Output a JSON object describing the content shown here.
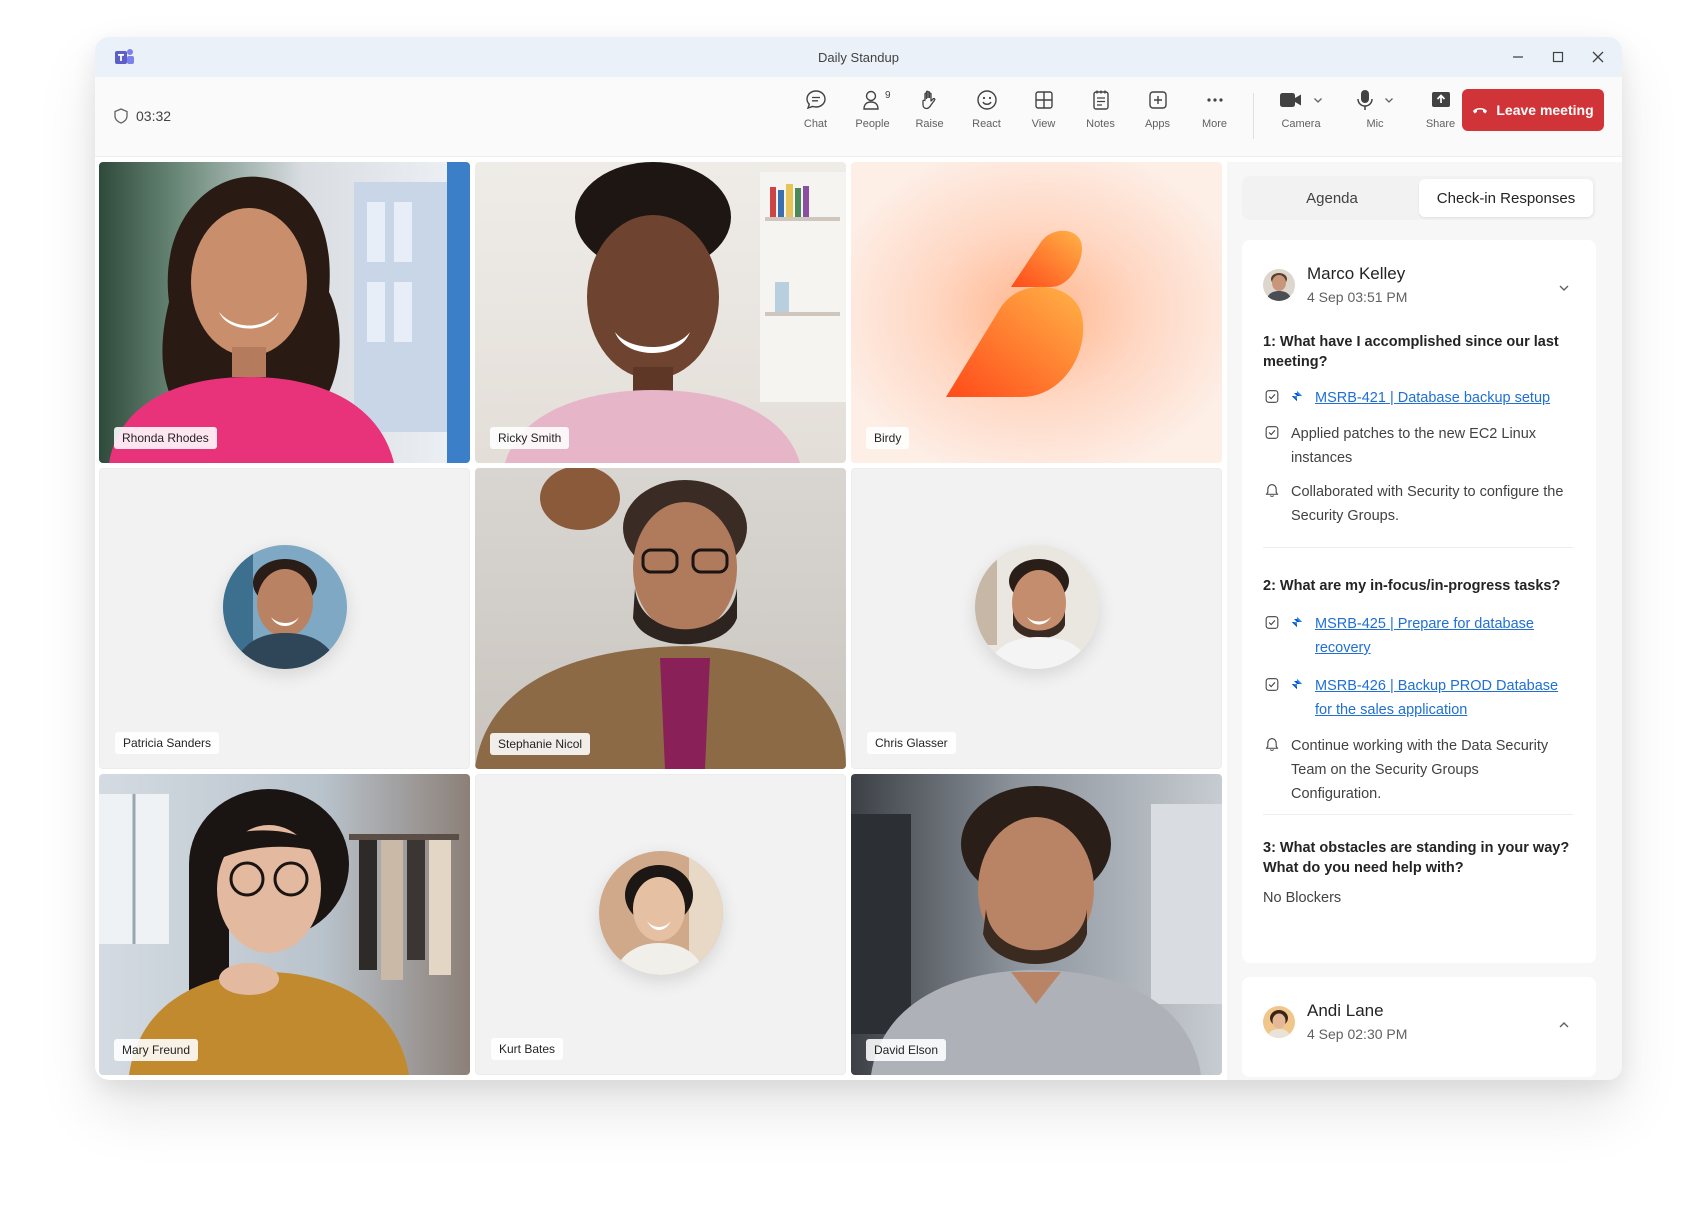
{
  "window": {
    "title": "Daily Standup"
  },
  "toolbar": {
    "timer": "03:32",
    "people_count": "9",
    "tools": [
      "Chat",
      "People",
      "Raise",
      "React",
      "View",
      "Notes",
      "Apps",
      "More"
    ],
    "camera": "Camera",
    "mic": "Mic",
    "share": "Share",
    "leave": "Leave meeting"
  },
  "participants": [
    "Rhonda Rhodes",
    "Ricky Smith",
    "Birdy",
    "Patricia Sanders",
    "Stephanie Nicol",
    "Chris Glasser",
    "Mary Freund",
    "Kurt Bates",
    "David Elson"
  ],
  "panel": {
    "tabs": [
      "Agenda",
      "Check-in Responses"
    ],
    "responses": [
      {
        "name": "Marco Kelley",
        "date": "4 Sep 03:51 PM",
        "q1": "1: What have I accomplished since our last meeting?",
        "q1_items": [
          "MSRB-421 | Database backup setup",
          "Applied patches to the new EC2 Linux instances",
          "Collaborated with Security to configure the Security Groups."
        ],
        "q2": "2: What are my in-focus/in-progress tasks?",
        "q2_items": [
          "MSRB-425 | Prepare for database recovery",
          "MSRB-426 | Backup PROD Database for the sales application",
          "Continue working with the Data Security Team on the Security Groups Configuration."
        ],
        "q3": "3: What obstacles are standing in your way? What do you need help with?",
        "q3_answer": "No Blockers"
      },
      {
        "name": "Andi Lane",
        "date": "4 Sep 02:30 PM"
      }
    ]
  },
  "colors": {
    "leave": "#d13438",
    "link": "#1f6fd6",
    "accent": "#5b5fc7"
  },
  "icons": [
    "app-logo-icon",
    "shield-icon",
    "chat-icon",
    "people-icon",
    "raise-hand-icon",
    "react-icon",
    "view-icon",
    "notes-icon",
    "apps-icon",
    "more-icon",
    "camera-icon",
    "mic-icon",
    "share-icon",
    "phone-hangup-icon",
    "checkbox-icon",
    "jira-icon",
    "bell-icon",
    "chevron-down-icon",
    "chevron-up-icon"
  ]
}
